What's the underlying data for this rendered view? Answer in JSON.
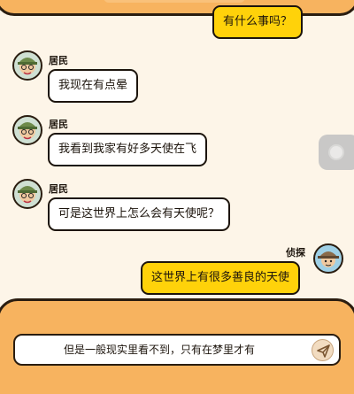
{
  "messages": [
    {
      "side": "right",
      "speaker": "",
      "text": "有什么事吗？",
      "avatar_icon": ""
    },
    {
      "side": "left",
      "speaker": "居民",
      "text": "我现在有点晕",
      "avatar_icon": "resident-avatar-icon"
    },
    {
      "side": "left",
      "speaker": "居民",
      "text": "我看到我家有好多天使在飞",
      "avatar_icon": "resident-avatar-icon"
    },
    {
      "side": "left",
      "speaker": "居民",
      "text": "可是这世界上怎么会有天使呢？",
      "avatar_icon": "resident-avatar-icon"
    },
    {
      "side": "right",
      "speaker": "侦探",
      "text": "这世界上有很多善良的天使",
      "avatar_icon": "detective-avatar-icon"
    }
  ],
  "input": {
    "text": "但是一般现实里看不到，只有在梦里才有",
    "send_icon": "send-icon"
  },
  "colors": {
    "background": "#fdf5e8",
    "panel": "#f7b35f",
    "bubble_player": "#ffd20a",
    "bubble_npc": "#ffffff"
  }
}
